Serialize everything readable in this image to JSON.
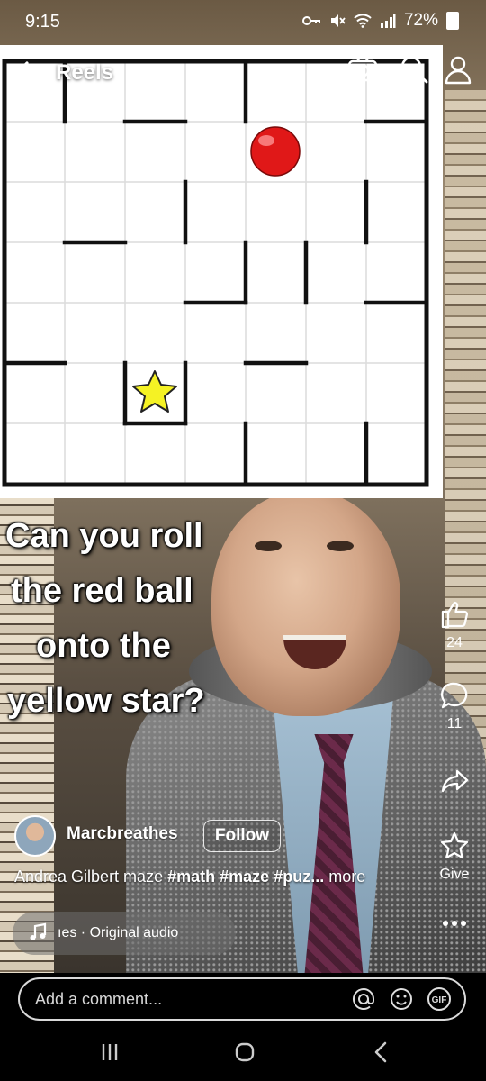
{
  "status_bar": {
    "time": "9:15",
    "battery": "72%"
  },
  "top_bar": {
    "title": "Reels",
    "icons": [
      "back-arrow-icon",
      "chevron-down-icon",
      "camera-icon",
      "search-icon",
      "profile-icon"
    ]
  },
  "video": {
    "caption_lines": [
      "Can you roll",
      "the red ball",
      "onto the",
      "yellow star?"
    ],
    "maze": {
      "grid": "7x7",
      "ball_color": "#e01818",
      "star_color": "#f5f224"
    }
  },
  "actions": {
    "like_count": "24",
    "comment_count": "11",
    "give_label": "Give",
    "icons": [
      "like-icon",
      "comment-icon",
      "share-icon",
      "give-icon",
      "more-icon"
    ]
  },
  "author": {
    "name": "Marcbreathes",
    "follow_label": "Follow"
  },
  "description": {
    "text": "Andrea Gilbert maze",
    "hashtags": [
      "#math",
      "#maze",
      "#puz..."
    ],
    "more_label": "more"
  },
  "audio": {
    "label": "ıes · Original audio"
  },
  "comment_box": {
    "placeholder": "Add a comment..."
  },
  "nav_bar": {
    "icons": [
      "recent-apps-icon",
      "home-icon",
      "back-icon"
    ]
  }
}
